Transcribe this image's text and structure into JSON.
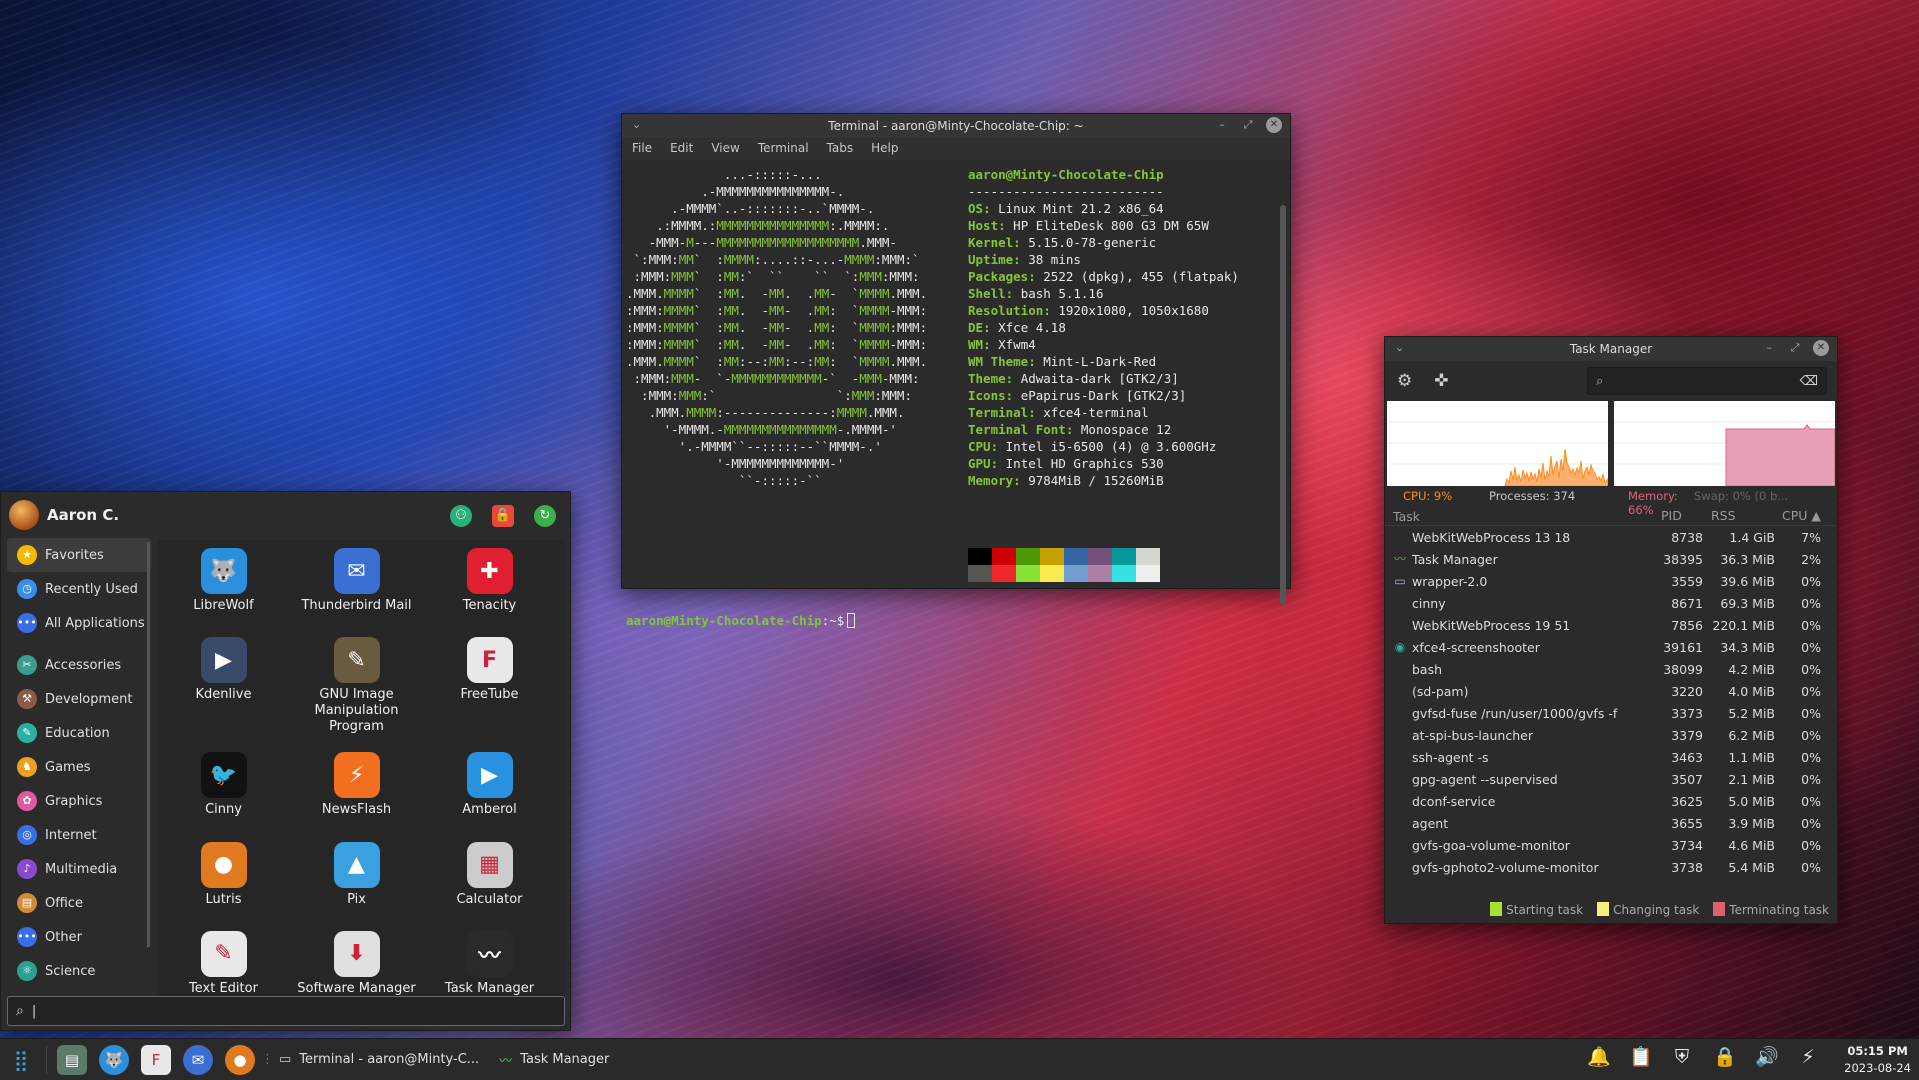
{
  "terminal": {
    "title": "Terminal - aaron@Minty-Chocolate-Chip: ~",
    "menu": [
      "File",
      "Edit",
      "View",
      "Terminal",
      "Tabs",
      "Help"
    ],
    "header": "aaron@Minty-Chocolate-Chip",
    "separator": "--------------------------",
    "info": [
      {
        "key": "OS",
        "value": "Linux Mint 21.2 x86_64"
      },
      {
        "key": "Host",
        "value": "HP EliteDesk 800 G3 DM 65W"
      },
      {
        "key": "Kernel",
        "value": "5.15.0-78-generic"
      },
      {
        "key": "Uptime",
        "value": "38 mins"
      },
      {
        "key": "Packages",
        "value": "2522 (dpkg), 455 (flatpak)"
      },
      {
        "key": "Shell",
        "value": "bash 5.1.16"
      },
      {
        "key": "Resolution",
        "value": "1920x1080, 1050x1680"
      },
      {
        "key": "DE",
        "value": "Xfce 4.18"
      },
      {
        "key": "WM",
        "value": "Xfwm4"
      },
      {
        "key": "WM Theme",
        "value": "Mint-L-Dark-Red"
      },
      {
        "key": "Theme",
        "value": "Adwaita-dark [GTK2/3]"
      },
      {
        "key": "Icons",
        "value": "ePapirus-Dark [GTK2/3]"
      },
      {
        "key": "Terminal",
        "value": "xfce4-terminal"
      },
      {
        "key": "Terminal Font",
        "value": "Monospace 12"
      },
      {
        "key": "CPU",
        "value": "Intel i5-6500 (4) @ 3.600GHz"
      },
      {
        "key": "GPU",
        "value": "Intel HD Graphics 530"
      },
      {
        "key": "Memory",
        "value": "9784MiB / 15260MiB"
      }
    ],
    "palette_top": [
      "#000000",
      "#cc0000",
      "#4e9a06",
      "#c4a000",
      "#3465a4",
      "#75507b",
      "#06989a",
      "#d3d7cf"
    ],
    "palette_bottom": [
      "#555753",
      "#ef2929",
      "#8ae234",
      "#fce94f",
      "#729fcf",
      "#ad7fa8",
      "#34e2e2",
      "#eeeeec"
    ],
    "prompt": "aaron@Minty-Chocolate-Chip",
    "prompt_suffix": ":~$"
  },
  "taskman": {
    "title": "Task Manager",
    "cpu": "CPU: 9%",
    "processes": "Processes: 374",
    "memory": "Memory: 66%",
    "swap": "Swap: 0% (0 b...",
    "headers": {
      "task": "Task",
      "pid": "PID",
      "rss": "RSS",
      "cpu": "CPU ▲"
    },
    "rows": [
      {
        "task": "WebKitWebProcess 13 18",
        "pid": "8738",
        "rss": "1.4 GiB",
        "cpu": "7%",
        "icon": ""
      },
      {
        "task": "Task Manager",
        "pid": "38395",
        "rss": "36.3 MiB",
        "cpu": "2%",
        "icon": "activity-icon"
      },
      {
        "task": "wrapper-2.0",
        "pid": "3559",
        "rss": "39.6 MiB",
        "cpu": "0%",
        "icon": "window-icon"
      },
      {
        "task": "cinny",
        "pid": "8671",
        "rss": "69.3 MiB",
        "cpu": "0%",
        "icon": ""
      },
      {
        "task": "WebKitWebProcess 19 51",
        "pid": "7856",
        "rss": "220.1 MiB",
        "cpu": "0%",
        "icon": ""
      },
      {
        "task": "xfce4-screenshooter",
        "pid": "39161",
        "rss": "34.3 MiB",
        "cpu": "0%",
        "icon": "screenshot-icon"
      },
      {
        "task": "bash",
        "pid": "38099",
        "rss": "4.2 MiB",
        "cpu": "0%",
        "icon": ""
      },
      {
        "task": "(sd-pam)",
        "pid": "3220",
        "rss": "4.0 MiB",
        "cpu": "0%",
        "icon": ""
      },
      {
        "task": "gvfsd-fuse /run/user/1000/gvfs -f",
        "pid": "3373",
        "rss": "5.2 MiB",
        "cpu": "0%",
        "icon": ""
      },
      {
        "task": "at-spi-bus-launcher",
        "pid": "3379",
        "rss": "6.2 MiB",
        "cpu": "0%",
        "icon": ""
      },
      {
        "task": "ssh-agent -s",
        "pid": "3463",
        "rss": "1.1 MiB",
        "cpu": "0%",
        "icon": ""
      },
      {
        "task": "gpg-agent --supervised",
        "pid": "3507",
        "rss": "2.1 MiB",
        "cpu": "0%",
        "icon": ""
      },
      {
        "task": "dconf-service",
        "pid": "3625",
        "rss": "5.0 MiB",
        "cpu": "0%",
        "icon": ""
      },
      {
        "task": "agent",
        "pid": "3655",
        "rss": "3.9 MiB",
        "cpu": "0%",
        "icon": ""
      },
      {
        "task": "gvfs-goa-volume-monitor",
        "pid": "3734",
        "rss": "4.6 MiB",
        "cpu": "0%",
        "icon": ""
      },
      {
        "task": "gvfs-gphoto2-volume-monitor",
        "pid": "3738",
        "rss": "5.4 MiB",
        "cpu": "0%",
        "icon": ""
      }
    ],
    "legend": {
      "starting": "Starting task",
      "changing": "Changing task",
      "terminating": "Terminating task"
    },
    "colors": {
      "cpu": "#ff8c1a",
      "memory": "#e0607a",
      "starting": "#a6e22e",
      "changing": "#f5f07a",
      "terminating": "#e06070"
    }
  },
  "appmenu": {
    "user": "Aaron C.",
    "categories": [
      {
        "label": "Favorites",
        "icon": "star-icon",
        "color": "#f5b800"
      },
      {
        "label": "Recently Used",
        "icon": "clock-icon",
        "color": "#3a8ee6"
      },
      {
        "label": "All Applications",
        "icon": "dots-icon",
        "color": "#3a6ee6"
      },
      {
        "label": "Accessories",
        "icon": "accessories-icon",
        "color": "#3a9e8e"
      },
      {
        "label": "Development",
        "icon": "development-icon",
        "color": "#8a5a4a"
      },
      {
        "label": "Education",
        "icon": "education-icon",
        "color": "#2ab0a0"
      },
      {
        "label": "Games",
        "icon": "games-icon",
        "color": "#f0a020"
      },
      {
        "label": "Graphics",
        "icon": "graphics-icon",
        "color": "#e05aa0"
      },
      {
        "label": "Internet",
        "icon": "internet-icon",
        "color": "#3a6ee6"
      },
      {
        "label": "Multimedia",
        "icon": "multimedia-icon",
        "color": "#8a4ad0"
      },
      {
        "label": "Office",
        "icon": "office-icon",
        "color": "#d08a3a"
      },
      {
        "label": "Other",
        "icon": "other-icon",
        "color": "#3a6ee6"
      },
      {
        "label": "Science",
        "icon": "science-icon",
        "color": "#2aa090"
      }
    ],
    "apps": [
      {
        "name": "LibreWolf",
        "icon": "librewolf-icon",
        "color": "#2a8fdc",
        "glyph": "🐺"
      },
      {
        "name": "Thunderbird Mail",
        "icon": "thunderbird-icon",
        "color": "#3a6ed0",
        "glyph": "✉"
      },
      {
        "name": "Tenacity",
        "icon": "tenacity-icon",
        "color": "#e02030",
        "glyph": "✚"
      },
      {
        "name": "Kdenlive",
        "icon": "kdenlive-icon",
        "color": "#3a4a6a",
        "glyph": "▶"
      },
      {
        "name": "GNU Image Manipulation Program",
        "icon": "gimp-icon",
        "color": "#6a5a40",
        "glyph": "✎"
      },
      {
        "name": "FreeTube",
        "icon": "freetube-icon",
        "color": "#e8e8e8",
        "glyph": "F"
      },
      {
        "name": "Cinny",
        "icon": "cinny-icon",
        "color": "#111111",
        "glyph": "🐦"
      },
      {
        "name": "NewsFlash",
        "icon": "newsflash-icon",
        "color": "#f07020",
        "glyph": "⚡"
      },
      {
        "name": "Amberol",
        "icon": "amberol-icon",
        "color": "#2a90e0",
        "glyph": "▶"
      },
      {
        "name": "Lutris",
        "icon": "lutris-icon",
        "color": "#e07a20",
        "glyph": "●"
      },
      {
        "name": "Pix",
        "icon": "pix-icon",
        "color": "#3aa0e0",
        "glyph": "▲"
      },
      {
        "name": "Calculator",
        "icon": "calculator-icon",
        "color": "#cccccc",
        "glyph": "▦"
      },
      {
        "name": "Text Editor",
        "icon": "text-editor-icon",
        "color": "#e8e8e8",
        "glyph": "✎"
      },
      {
        "name": "Software Manager",
        "icon": "software-manager-icon",
        "color": "#e0e0e0",
        "glyph": "⬇"
      },
      {
        "name": "Task Manager",
        "icon": "task-manager-icon",
        "color": "#2a2a2a",
        "glyph": "〰"
      }
    ],
    "search_value": ""
  },
  "taskbar": {
    "tasks": [
      {
        "label": "Terminal - aaron@Minty-C...",
        "icon": "terminal-icon"
      },
      {
        "label": "Task Manager",
        "icon": "activity-icon"
      }
    ],
    "clock_time": "05:15 PM",
    "clock_date": "2023-08-24"
  }
}
